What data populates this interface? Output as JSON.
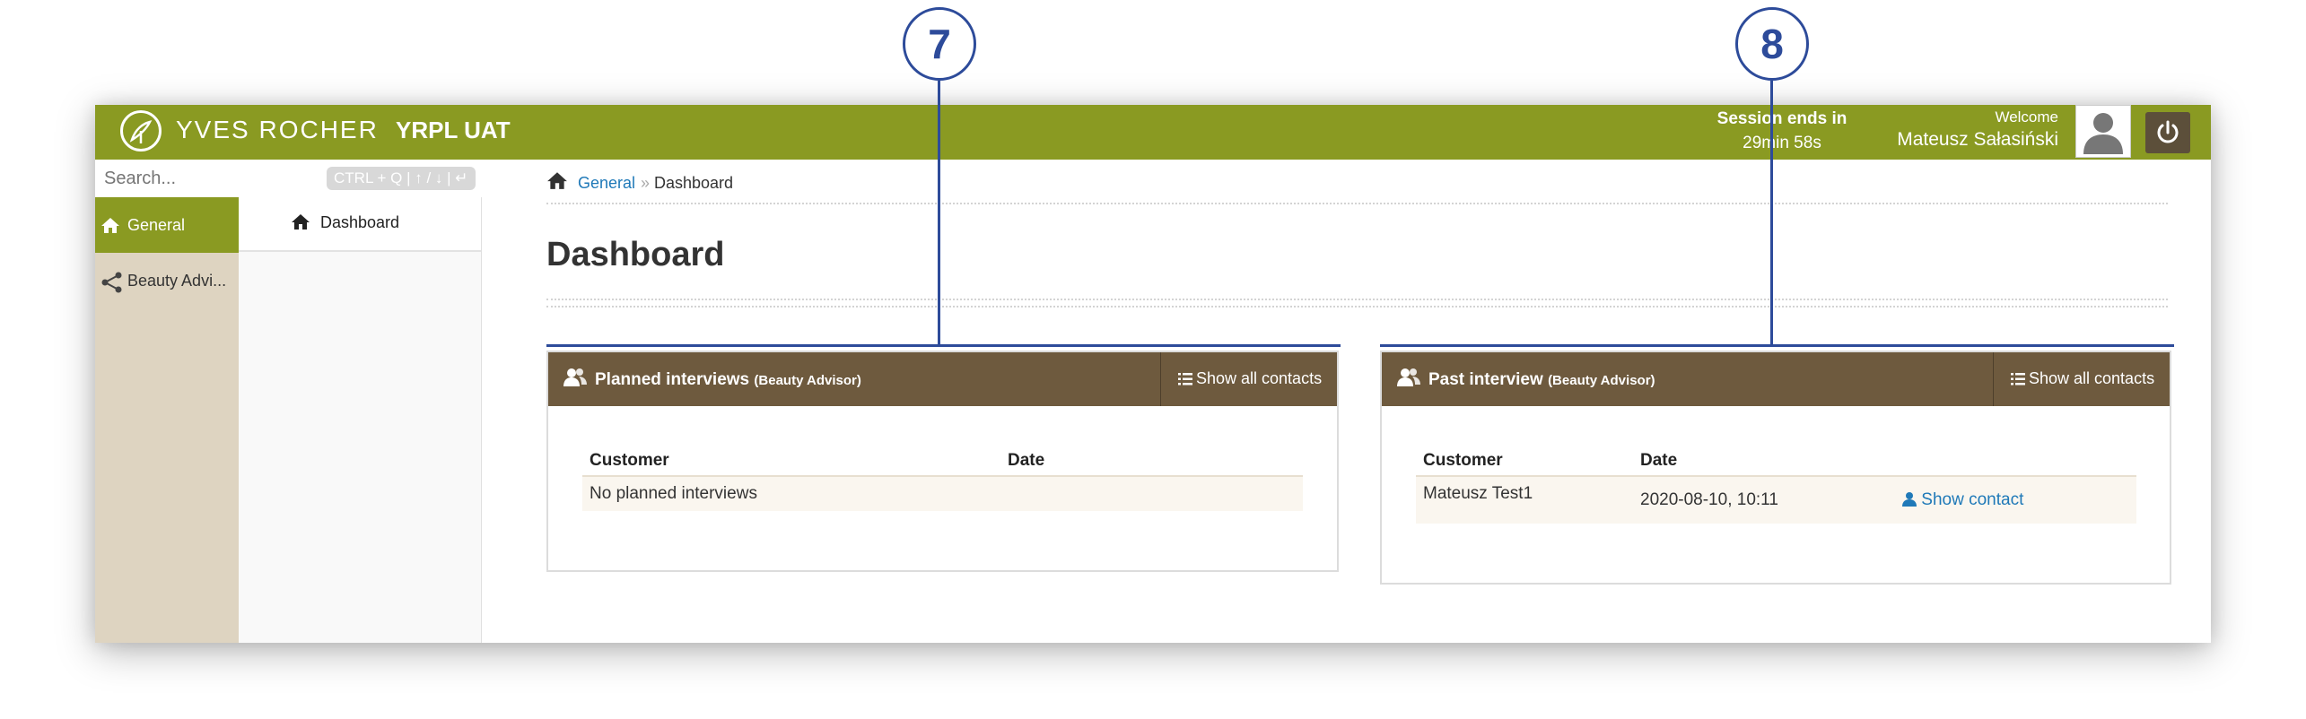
{
  "header": {
    "brand": "YVES ROCHER",
    "app_name": "YRPL UAT",
    "session_label": "Session ends in",
    "session_time": "29min 58s",
    "welcome_label": "Welcome",
    "user_name": "Mateusz Sałasiński"
  },
  "search": {
    "placeholder": "Search...",
    "shortcut_hint": "CTRL + Q | ↑ / ↓ | ↵"
  },
  "sidebar": {
    "items": [
      {
        "label": "General",
        "icon": "home-icon",
        "active": true
      },
      {
        "label": "Beauty Advi...",
        "icon": "share-icon",
        "active": false
      }
    ]
  },
  "submenu": {
    "items": [
      {
        "label": "Dashboard",
        "icon": "home-icon"
      }
    ]
  },
  "breadcrumb": {
    "link": "General",
    "separator": "»",
    "current": "Dashboard"
  },
  "page": {
    "title": "Dashboard"
  },
  "panels": {
    "planned": {
      "title": "Planned interviews",
      "subtitle": "(Beauty Advisor)",
      "button": "Show all contacts",
      "columns": [
        "Customer",
        "Date"
      ],
      "empty_text": "No planned interviews"
    },
    "past": {
      "title": "Past interview",
      "subtitle": "(Beauty Advisor)",
      "button": "Show all contacts",
      "columns": [
        "Customer",
        "Date"
      ],
      "rows": [
        {
          "customer": "Mateusz Test1",
          "date": "2020-08-10, 10:11",
          "action": "Show contact"
        }
      ]
    }
  },
  "annotations": [
    "7",
    "8"
  ],
  "colors": {
    "topbar": "#8a9a22",
    "panel_header": "#6e5a3e",
    "sidebar": "#ded4c1",
    "link": "#1f79b8",
    "annotation": "#2d4b9a"
  }
}
